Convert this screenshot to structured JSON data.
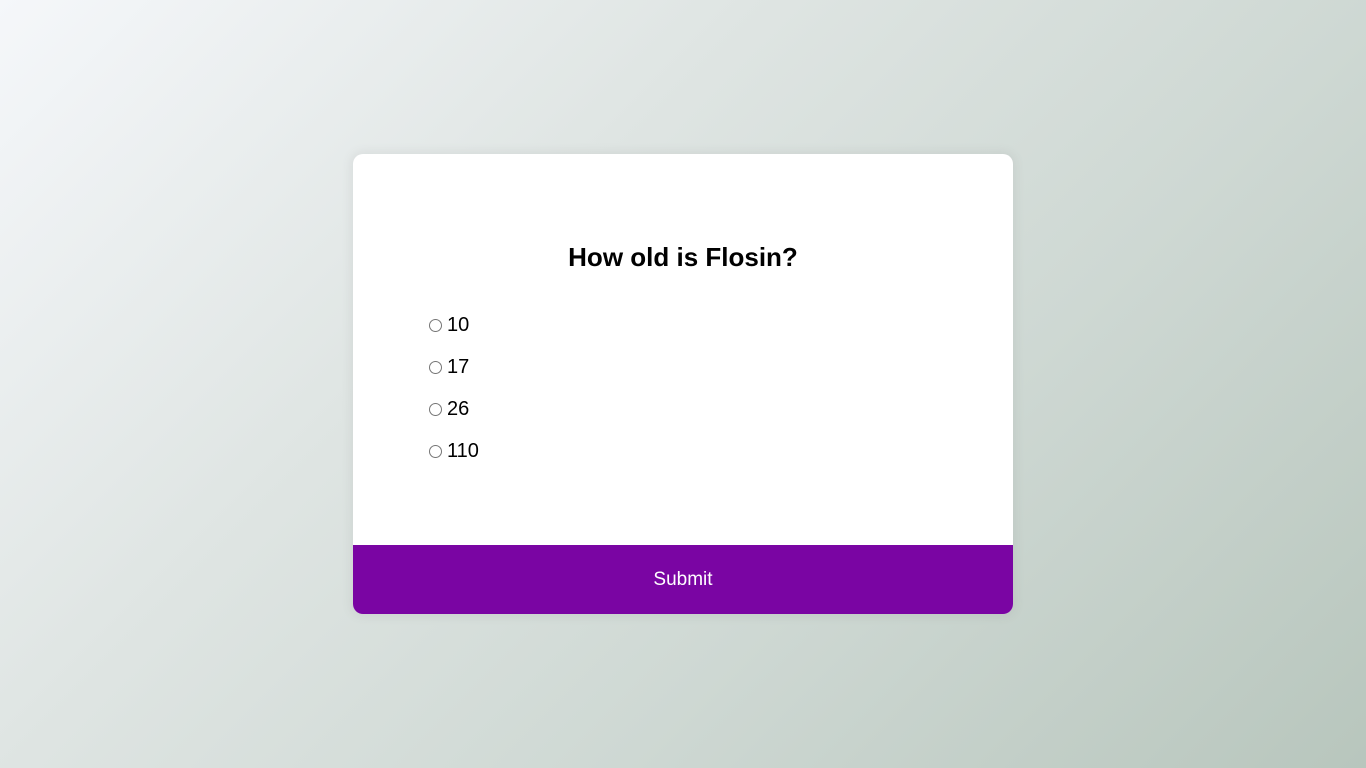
{
  "quiz": {
    "question": "How old is Flosin?",
    "answers": [
      {
        "label": "10",
        "selected": false
      },
      {
        "label": "17",
        "selected": false
      },
      {
        "label": "26",
        "selected": false
      },
      {
        "label": "110",
        "selected": false
      }
    ],
    "submit_label": "Submit"
  },
  "colors": {
    "accent": "#7a05a3",
    "card_background": "#ffffff",
    "text": "#000000"
  },
  "icons": {
    "answer_radio": "radio-unchecked-icon"
  }
}
